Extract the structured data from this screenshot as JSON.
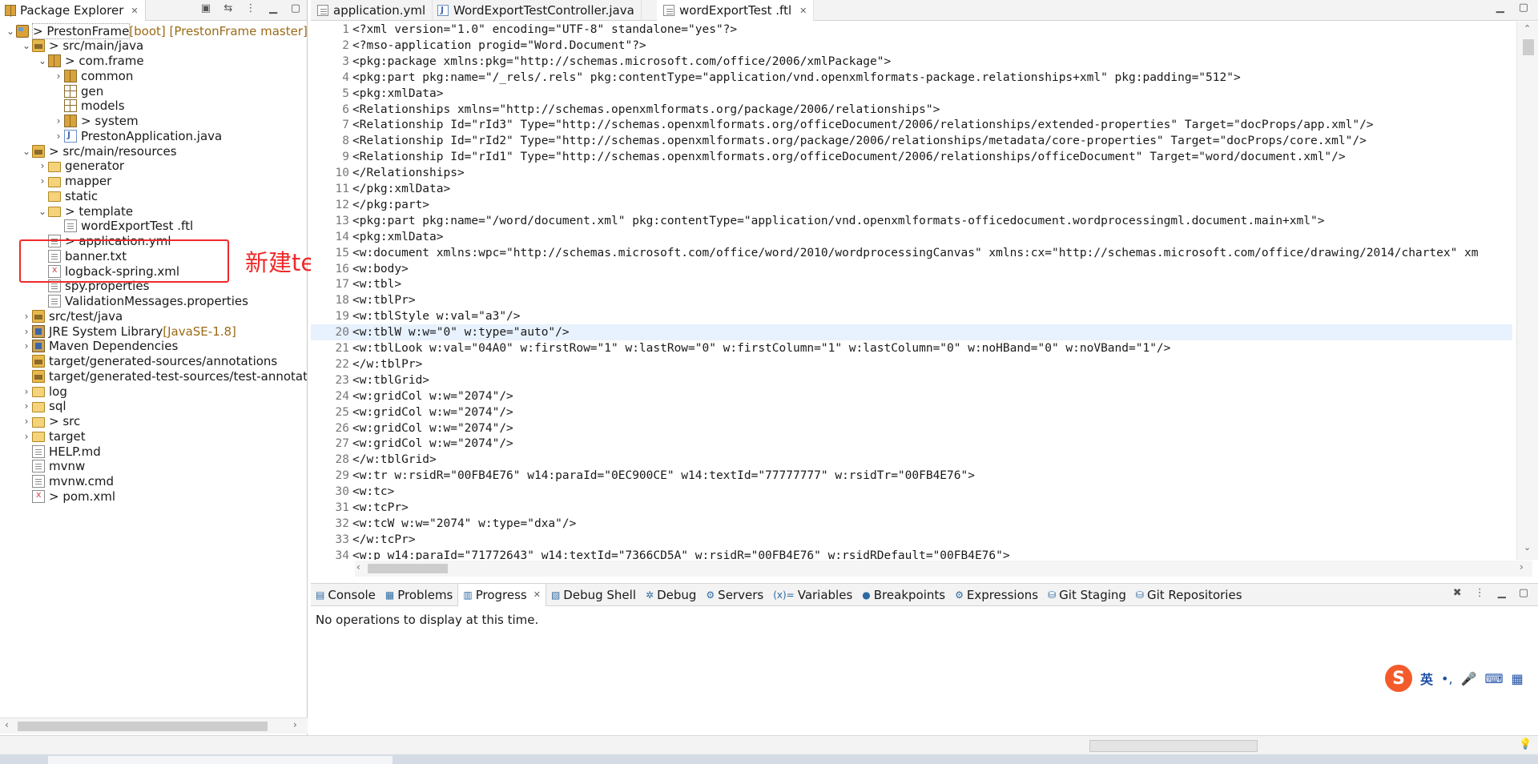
{
  "explorer": {
    "title": "Package Explorer",
    "close": "✕",
    "tools": [
      "▣",
      "⇆",
      "⋮",
      "▁",
      "▢"
    ],
    "tree": [
      {
        "indent": 0,
        "tw": "⌄",
        "icon": "i-proj",
        "deco": "",
        "label": "> PrestonFrame",
        "extra": " [boot] [PrestonFrame master]",
        "name": "project-prestonframe",
        "sel": true
      },
      {
        "indent": 1,
        "tw": "⌄",
        "icon": "i-srcf",
        "deco": "",
        "label": "> src/main/java",
        "extra": "",
        "name": "src-main-java"
      },
      {
        "indent": 2,
        "tw": "⌄",
        "icon": "i-pkgfill",
        "deco": "",
        "label": "> com.frame",
        "extra": "",
        "name": "pkg-com-frame"
      },
      {
        "indent": 3,
        "tw": "›",
        "icon": "i-pkgfill",
        "deco": "",
        "label": "common",
        "extra": "",
        "name": "pkg-common"
      },
      {
        "indent": 3,
        "tw": "",
        "icon": "i-pkg",
        "deco": "",
        "label": "gen",
        "extra": "",
        "name": "pkg-gen"
      },
      {
        "indent": 3,
        "tw": "",
        "icon": "i-pkg",
        "deco": "",
        "label": "models",
        "extra": "",
        "name": "pkg-models"
      },
      {
        "indent": 3,
        "tw": "›",
        "icon": "i-pkgfill",
        "deco": "",
        "label": "> system",
        "extra": "",
        "name": "pkg-system"
      },
      {
        "indent": 3,
        "tw": "›",
        "icon": "i-java",
        "deco": "",
        "label": "PrestonApplication.java",
        "extra": "",
        "name": "file-preston-application"
      },
      {
        "indent": 1,
        "tw": "⌄",
        "icon": "i-srcf",
        "deco": "",
        "label": "> src/main/resources",
        "extra": "",
        "name": "src-main-resources"
      },
      {
        "indent": 2,
        "tw": "›",
        "icon": "i-folder",
        "deco": "",
        "label": "generator",
        "extra": "",
        "name": "folder-generator"
      },
      {
        "indent": 2,
        "tw": "›",
        "icon": "i-folder",
        "deco": "",
        "label": "mapper",
        "extra": "",
        "name": "folder-mapper"
      },
      {
        "indent": 2,
        "tw": "",
        "icon": "i-folder",
        "deco": "",
        "label": "static",
        "extra": "",
        "name": "folder-static"
      },
      {
        "indent": 2,
        "tw": "⌄",
        "icon": "i-folder",
        "deco": "",
        "label": "> template",
        "extra": "",
        "name": "folder-template"
      },
      {
        "indent": 3,
        "tw": "",
        "icon": "i-file",
        "deco": "",
        "label": "wordExportTest .ftl",
        "extra": "",
        "name": "file-wordexporttest-ftl"
      },
      {
        "indent": 2,
        "tw": "",
        "icon": "i-file",
        "deco": "",
        "label": "> application.yml",
        "extra": "",
        "name": "file-application-yml"
      },
      {
        "indent": 2,
        "tw": "",
        "icon": "i-file",
        "deco": "",
        "label": "banner.txt",
        "extra": "",
        "name": "file-banner-txt"
      },
      {
        "indent": 2,
        "tw": "",
        "icon": "i-xml",
        "deco": "",
        "label": "logback-spring.xml",
        "extra": "",
        "name": "file-logback-spring"
      },
      {
        "indent": 2,
        "tw": "",
        "icon": "i-file",
        "deco": "",
        "label": "spy.properties",
        "extra": "",
        "name": "file-spy-properties"
      },
      {
        "indent": 2,
        "tw": "",
        "icon": "i-file",
        "deco": "",
        "label": "ValidationMessages.properties",
        "extra": "",
        "name": "file-validation-messages"
      },
      {
        "indent": 1,
        "tw": "›",
        "icon": "i-srcf",
        "deco": "",
        "label": "src/test/java",
        "extra": "",
        "name": "src-test-java"
      },
      {
        "indent": 1,
        "tw": "›",
        "icon": "i-lib",
        "deco": "",
        "label": "JRE System Library",
        "extra": " [JavaSE-1.8]",
        "name": "jre-system-library"
      },
      {
        "indent": 1,
        "tw": "›",
        "icon": "i-lib",
        "deco": "",
        "label": "Maven Dependencies",
        "extra": "",
        "name": "maven-dependencies"
      },
      {
        "indent": 1,
        "tw": "",
        "icon": "i-srcf",
        "deco": "",
        "label": "target/generated-sources/annotations",
        "extra": "",
        "name": "target-generated-sources"
      },
      {
        "indent": 1,
        "tw": "",
        "icon": "i-srcf",
        "deco": "",
        "label": "target/generated-test-sources/test-annotat",
        "extra": "",
        "name": "target-generated-test-sources"
      },
      {
        "indent": 1,
        "tw": "›",
        "icon": "i-folder",
        "deco": "",
        "label": "log",
        "extra": "",
        "name": "folder-log"
      },
      {
        "indent": 1,
        "tw": "›",
        "icon": "i-folder",
        "deco": "",
        "label": "sql",
        "extra": "",
        "name": "folder-sql"
      },
      {
        "indent": 1,
        "tw": "›",
        "icon": "i-folder",
        "deco": "",
        "label": "> src",
        "extra": "",
        "name": "folder-src"
      },
      {
        "indent": 1,
        "tw": "›",
        "icon": "i-folder",
        "deco": "",
        "label": "target",
        "extra": "",
        "name": "folder-target"
      },
      {
        "indent": 1,
        "tw": "",
        "icon": "i-file",
        "deco": "",
        "label": "HELP.md",
        "extra": "",
        "name": "file-help-md"
      },
      {
        "indent": 1,
        "tw": "",
        "icon": "i-file",
        "deco": "",
        "label": "mvnw",
        "extra": "",
        "name": "file-mvnw"
      },
      {
        "indent": 1,
        "tw": "",
        "icon": "i-file",
        "deco": "",
        "label": "mvnw.cmd",
        "extra": "",
        "name": "file-mvnw-cmd"
      },
      {
        "indent": 1,
        "tw": "",
        "icon": "i-xml",
        "deco": "",
        "label": "> pom.xml",
        "extra": "",
        "name": "file-pom-xml"
      }
    ]
  },
  "annotation": "新建template文件夹，把ftl文件放进去",
  "editor": {
    "tabs": [
      {
        "label": "application.yml",
        "active": false,
        "close": ""
      },
      {
        "label": "WordExportTestController.java",
        "active": false,
        "close": ""
      },
      {
        "label": "wordExportTest .ftl",
        "active": true,
        "close": "✕"
      }
    ],
    "minmax": [
      "▁",
      "▢"
    ],
    "current_line": 20,
    "lines": [
      "<?xml version=\"1.0\" encoding=\"UTF-8\" standalone=\"yes\"?>",
      "<?mso-application progid=\"Word.Document\"?>",
      "<pkg:package xmlns:pkg=\"http://schemas.microsoft.com/office/2006/xmlPackage\">",
      "<pkg:part pkg:name=\"/_rels/.rels\" pkg:contentType=\"application/vnd.openxmlformats-package.relationships+xml\" pkg:padding=\"512\">",
      "<pkg:xmlData>",
      "<Relationships xmlns=\"http://schemas.openxmlformats.org/package/2006/relationships\">",
      "<Relationship Id=\"rId3\" Type=\"http://schemas.openxmlformats.org/officeDocument/2006/relationships/extended-properties\" Target=\"docProps/app.xml\"/>",
      "<Relationship Id=\"rId2\" Type=\"http://schemas.openxmlformats.org/package/2006/relationships/metadata/core-properties\" Target=\"docProps/core.xml\"/>",
      "<Relationship Id=\"rId1\" Type=\"http://schemas.openxmlformats.org/officeDocument/2006/relationships/officeDocument\" Target=\"word/document.xml\"/>",
      "</Relationships>",
      "</pkg:xmlData>",
      "</pkg:part>",
      "<pkg:part pkg:name=\"/word/document.xml\" pkg:contentType=\"application/vnd.openxmlformats-officedocument.wordprocessingml.document.main+xml\">",
      "<pkg:xmlData>",
      "<w:document xmlns:wpc=\"http://schemas.microsoft.com/office/word/2010/wordprocessingCanvas\" xmlns:cx=\"http://schemas.microsoft.com/office/drawing/2014/chartex\" xm",
      "<w:body>",
      "<w:tbl>",
      "<w:tblPr>",
      "<w:tblStyle w:val=\"a3\"/>",
      "<w:tblW w:w=\"0\" w:type=\"auto\"/>",
      "<w:tblLook w:val=\"04A0\" w:firstRow=\"1\" w:lastRow=\"0\" w:firstColumn=\"1\" w:lastColumn=\"0\" w:noHBand=\"0\" w:noVBand=\"1\"/>",
      "</w:tblPr>",
      "<w:tblGrid>",
      "<w:gridCol w:w=\"2074\"/>",
      "<w:gridCol w:w=\"2074\"/>",
      "<w:gridCol w:w=\"2074\"/>",
      "<w:gridCol w:w=\"2074\"/>",
      "</w:tblGrid>",
      "<w:tr w:rsidR=\"00FB4E76\" w14:paraId=\"0EC900CE\" w14:textId=\"77777777\" w:rsidTr=\"00FB4E76\">",
      "<w:tc>",
      "<w:tcPr>",
      "<w:tcW w:w=\"2074\" w:type=\"dxa\"/>",
      "</w:tcPr>",
      "<w:p w14:paraId=\"71772643\" w14:textId=\"7366CD5A\" w:rsidR=\"00FB4E76\" w:rsidRDefault=\"00FB4E76\">"
    ]
  },
  "bottom": {
    "tabs": [
      {
        "icon": "▤",
        "label": "Console",
        "active": false
      },
      {
        "icon": "▦",
        "label": "Problems",
        "active": false
      },
      {
        "icon": "▥",
        "label": "Progress",
        "active": true,
        "close": "✕"
      },
      {
        "icon": "▧",
        "label": "Debug Shell",
        "active": false
      },
      {
        "icon": "✲",
        "label": "Debug",
        "active": false
      },
      {
        "icon": "⚙",
        "label": "Servers",
        "active": false
      },
      {
        "icon": "(x)=",
        "label": "Variables",
        "active": false
      },
      {
        "icon": "●",
        "label": "Breakpoints",
        "active": false
      },
      {
        "icon": "⚙",
        "label": "Expressions",
        "active": false
      },
      {
        "icon": "⛁",
        "label": "Git Staging",
        "active": false
      },
      {
        "icon": "⛁",
        "label": "Git Repositories",
        "active": false
      }
    ],
    "tools": [
      "✖",
      "⋮",
      "▁",
      "▢"
    ],
    "message": "No operations to display at this time."
  },
  "ime": {
    "logo": "S",
    "lang": "英",
    "items": [
      "•,",
      "🎤",
      "⌨",
      "▦"
    ]
  },
  "status": {
    "bulb": "💡"
  }
}
